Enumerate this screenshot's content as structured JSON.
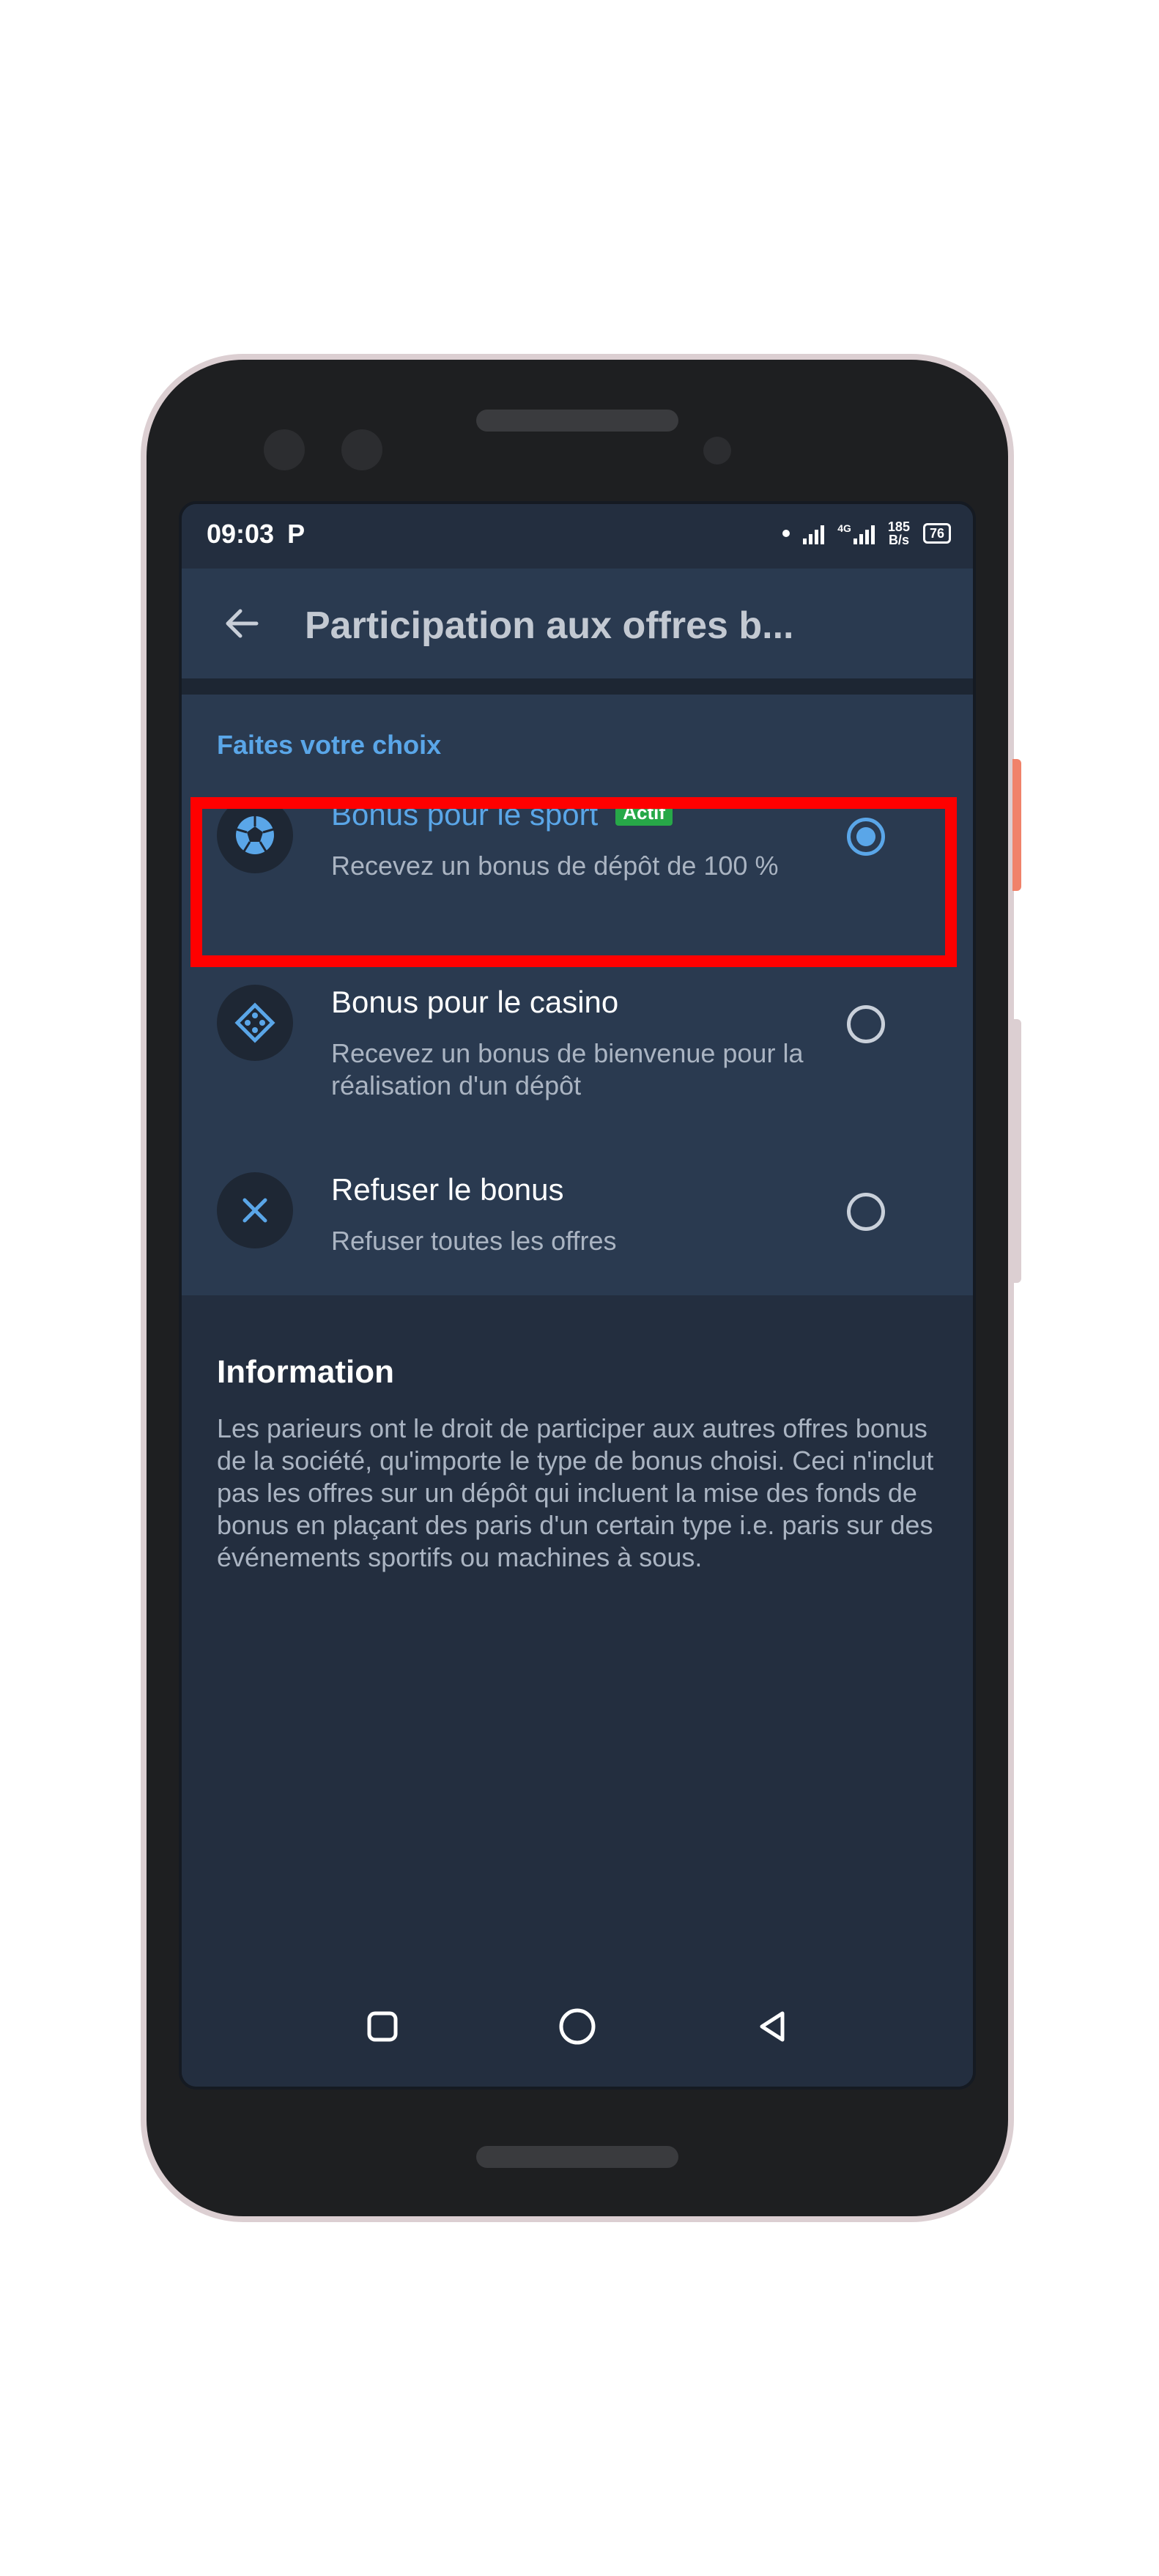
{
  "status_bar": {
    "time": "09:03",
    "notification_icon": "P",
    "network_label": "4G",
    "speed_value": "185",
    "speed_unit": "B/s",
    "battery": "76"
  },
  "app_bar": {
    "back_icon": "arrow-left-icon",
    "title": "Participation aux offres b..."
  },
  "choices": {
    "section_label": "Faites votre choix",
    "options": [
      {
        "icon": "soccer-ball-icon",
        "title": "Bonus pour le sport",
        "badge": "Actif",
        "description": "Recevez un bonus de dépôt de 100 %",
        "selected": true
      },
      {
        "icon": "casino-chip-icon",
        "title": "Bonus pour le casino",
        "description": "Recevez un bonus de bienvenue pour la réalisation d'un dépôt",
        "selected": false
      },
      {
        "icon": "close-x-icon",
        "title": "Refuser le bonus",
        "description": "Refuser toutes les offres",
        "selected": false
      }
    ]
  },
  "information": {
    "title": "Information",
    "text": "Les parieurs ont le droit de participer aux autres offres bonus de la société, qu'importe le type de bonus choisi. Ceci n'inclut pas les offres sur un dépôt qui incluent la mise des fonds de bonus en plaçant des paris d'un certain type i.e. paris sur des événements sportifs ou machines à sous."
  },
  "colors": {
    "accent": "#5aa6e8",
    "badge": "#27a848",
    "highlight": "#ff0000",
    "panel": "#2a3a50",
    "background": "#232e3f"
  }
}
